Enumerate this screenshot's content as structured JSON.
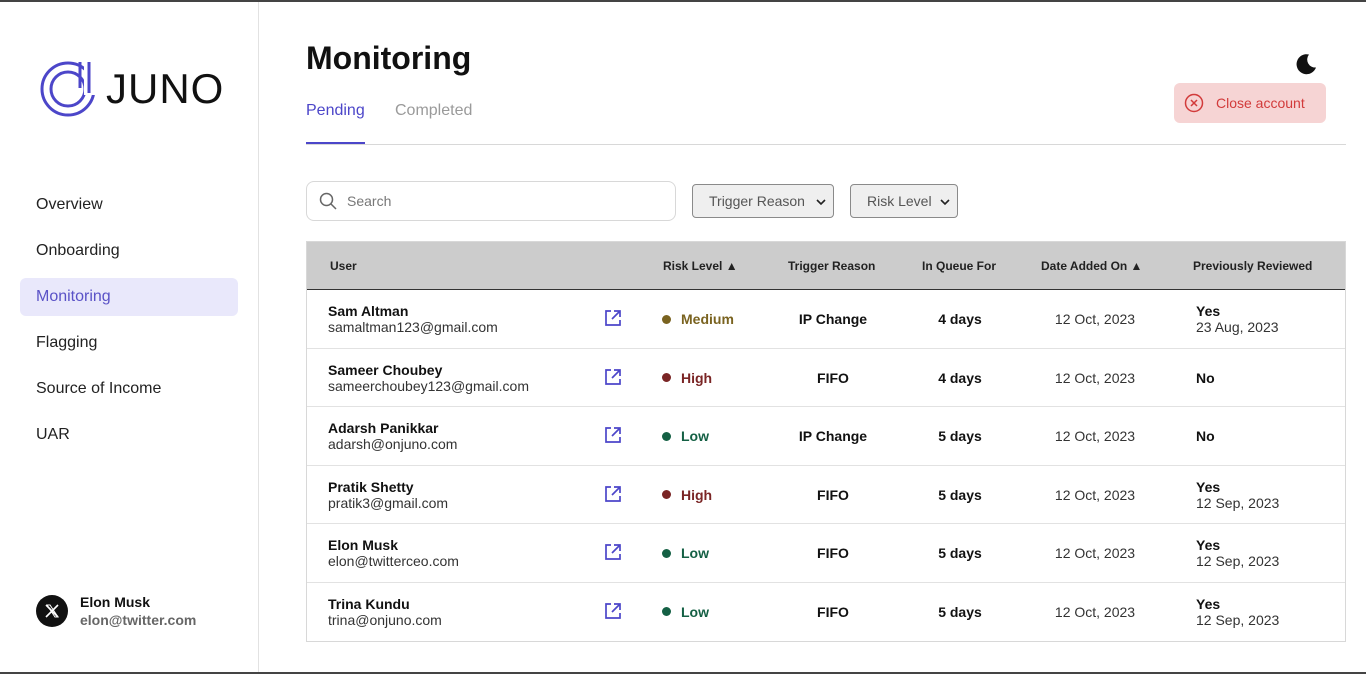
{
  "brand": {
    "name": "JUNO"
  },
  "sidebar": {
    "items": [
      {
        "label": "Overview",
        "active": false
      },
      {
        "label": "Onboarding",
        "active": false
      },
      {
        "label": "Monitoring",
        "active": true
      },
      {
        "label": "Flagging",
        "active": false
      },
      {
        "label": "Source of Income",
        "active": false
      },
      {
        "label": "UAR",
        "active": false
      }
    ],
    "profile": {
      "name": "Elon Musk",
      "email": "elon@twitter.com",
      "icon": "x-logo-icon"
    }
  },
  "header": {
    "title": "Monitoring",
    "tabs": [
      {
        "label": "Pending"
      },
      {
        "label": "Completed"
      }
    ],
    "close_account_label": "Close account",
    "theme_icon": "moon-icon"
  },
  "filters": {
    "search_placeholder": "Search",
    "trigger_reason": "Trigger Reason",
    "risk_level": "Risk Level"
  },
  "colors": {
    "accent": "#4c46c9",
    "risk_medium": "#7a6320",
    "risk_high": "#7a2525",
    "risk_low": "#146044",
    "close_bg": "#f6d4d4",
    "close_fg": "#d23b3b"
  },
  "table": {
    "columns": [
      "User",
      "Risk Level ▲",
      "Trigger Reason",
      "In Queue For",
      "Date Added On ▲",
      "Previously Reviewed"
    ],
    "rows": [
      {
        "name": "Sam Altman",
        "email": "samaltman123@gmail.com",
        "risk": "Medium",
        "trigger": "IP Change",
        "queue": "4 days",
        "date": "12 Oct, 2023",
        "reviewed": "Yes",
        "reviewed_date": "23 Aug, 2023"
      },
      {
        "name": "Sameer Choubey",
        "email": "sameerchoubey123@gmail.com",
        "risk": "High",
        "trigger": "FIFO",
        "queue": "4 days",
        "date": "12 Oct, 2023",
        "reviewed": "No",
        "reviewed_date": ""
      },
      {
        "name": "Adarsh Panikkar",
        "email": "adarsh@onjuno.com",
        "risk": "Low",
        "trigger": "IP Change",
        "queue": "5 days",
        "date": "12 Oct, 2023",
        "reviewed": "No",
        "reviewed_date": ""
      },
      {
        "name": "Pratik Shetty",
        "email": "pratik3@gmail.com",
        "risk": "High",
        "trigger": "FIFO",
        "queue": "5 days",
        "date": "12 Oct, 2023",
        "reviewed": "Yes",
        "reviewed_date": "12 Sep, 2023"
      },
      {
        "name": "Elon Musk",
        "email": "elon@twitterceo.com",
        "risk": "Low",
        "trigger": "FIFO",
        "queue": "5 days",
        "date": "12 Oct, 2023",
        "reviewed": "Yes",
        "reviewed_date": "12 Sep, 2023"
      },
      {
        "name": "Trina Kundu",
        "email": "trina@onjuno.com",
        "risk": "Low",
        "trigger": "FIFO",
        "queue": "5 days",
        "date": "12 Oct, 2023",
        "reviewed": "Yes",
        "reviewed_date": "12 Sep, 2023"
      }
    ]
  }
}
